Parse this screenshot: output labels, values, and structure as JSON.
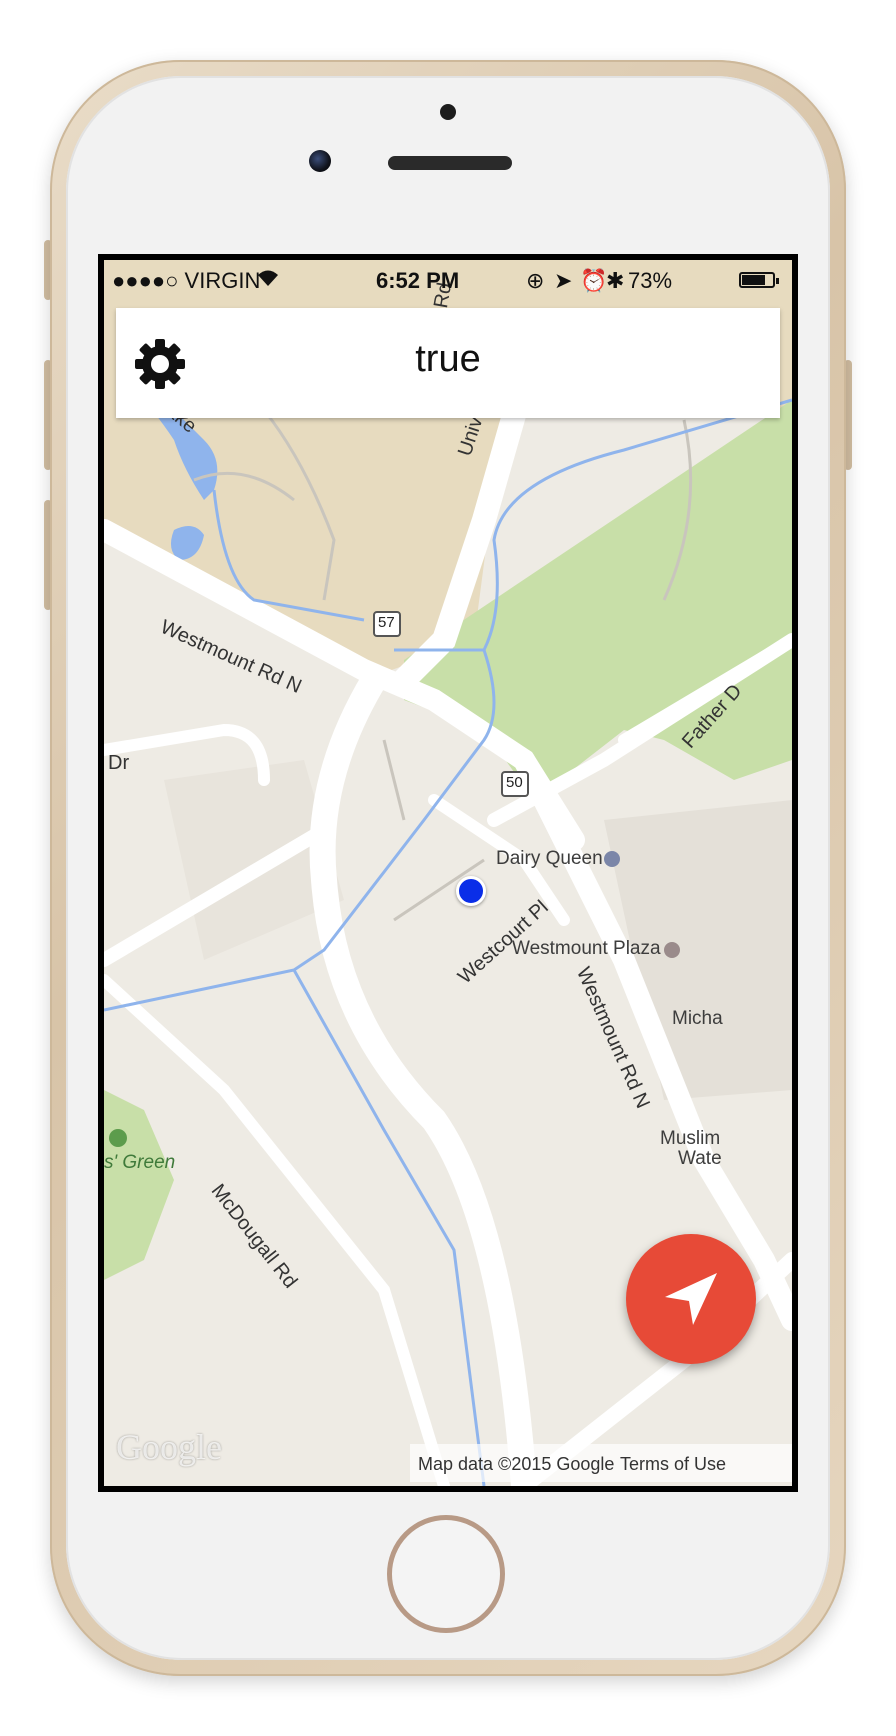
{
  "status_bar": {
    "carrier": "●●●●○ VIRGIN",
    "time": "6:52 PM",
    "battery_percent": "73%",
    "battery_level": 0.73
  },
  "header": {
    "title": "true",
    "settings_icon": "gear-icon"
  },
  "map": {
    "road_labels": {
      "westmount_rd_n_upper": "Westmount Rd N",
      "westmount_rd_n_lower": "Westmount Rd N",
      "mcdougall_rd": "McDougall Rd",
      "westcourt_pl": "Westcourt Pl",
      "university": "Univ",
      "father_d": "Father D",
      "dr": "Dr",
      "lake": "ake",
      "rd_top": "Rd"
    },
    "route_shields": {
      "route_57": "57",
      "route_50": "50"
    },
    "poi_labels": {
      "dairy_queen": "Dairy Queen",
      "westmount_plaza": "Westmount Plaza",
      "micha": "Micha",
      "muslim": "Muslim",
      "wate": "Wate",
      "green": "s' Green"
    },
    "google_logo": "Google",
    "attribution": "Map data ©2015 Google",
    "terms": "Terms of Use"
  },
  "colors": {
    "fab": "#e74a37",
    "location_dot": "#0a2ee8",
    "park": "#c8dfa8",
    "water": "#8fb4ec",
    "land": "#eeebe4",
    "campus": "#e7dbbf"
  },
  "icons": {
    "fab_icon": "navigation-arrow-icon"
  }
}
